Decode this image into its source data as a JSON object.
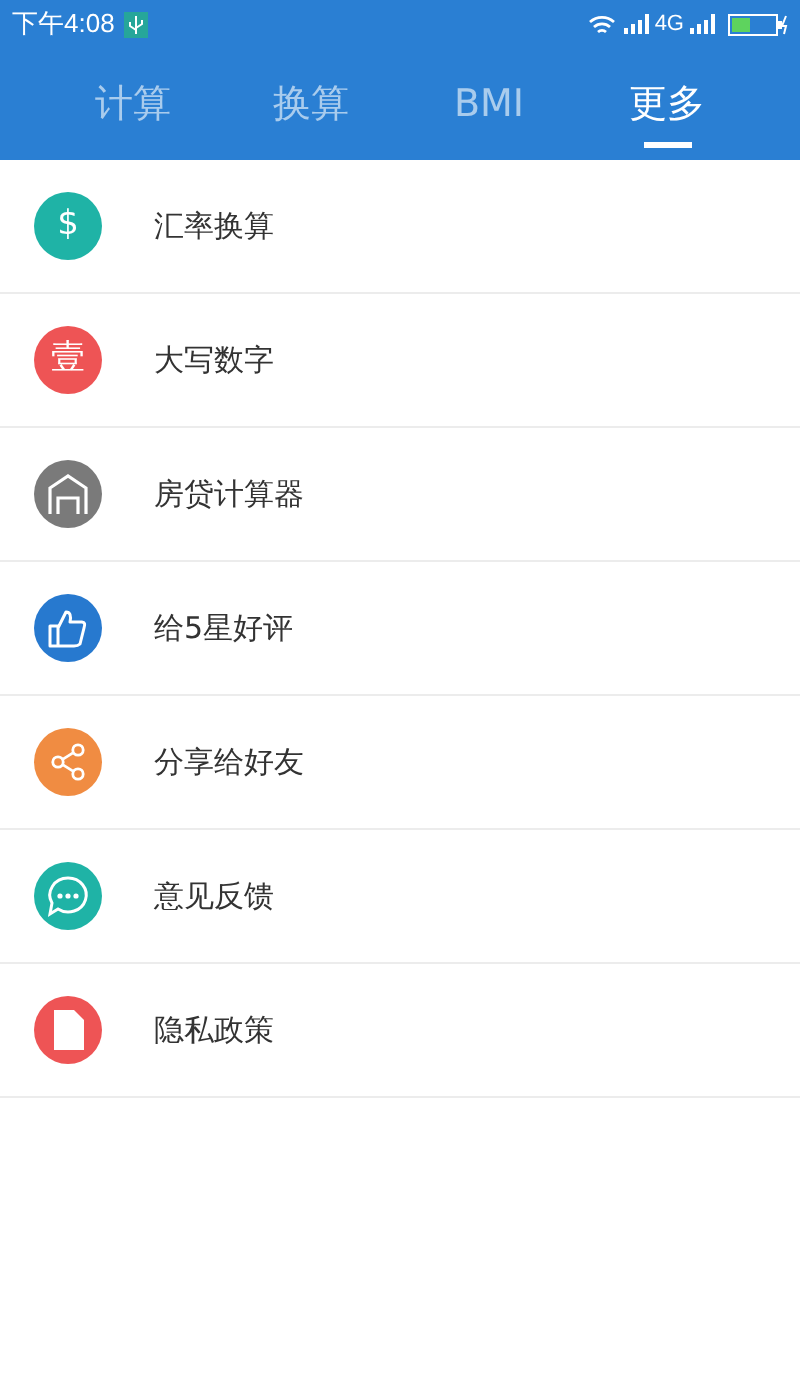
{
  "status_bar": {
    "time": "下午4:08",
    "network": "4G"
  },
  "tabs": [
    {
      "label": "计算",
      "selected": false
    },
    {
      "label": "换算",
      "selected": false
    },
    {
      "label": "BMI",
      "selected": false
    },
    {
      "label": "更多",
      "selected": true
    }
  ],
  "menu": [
    {
      "label": "汇率换算",
      "color": "#1fb3a6",
      "kind": "glyph",
      "glyph": "$"
    },
    {
      "label": "大写数字",
      "color": "#ee5455",
      "kind": "glyph",
      "glyph": "壹"
    },
    {
      "label": "房贷计算器",
      "color": "#7a7a7a",
      "kind": "house"
    },
    {
      "label": "给5星好评",
      "color": "#2779cf",
      "kind": "thumb"
    },
    {
      "label": "分享给好友",
      "color": "#f08c42",
      "kind": "share"
    },
    {
      "label": "意见反馈",
      "color": "#1fb3a6",
      "kind": "chat"
    },
    {
      "label": "隐私政策",
      "color": "#ee5455",
      "kind": "document"
    }
  ]
}
